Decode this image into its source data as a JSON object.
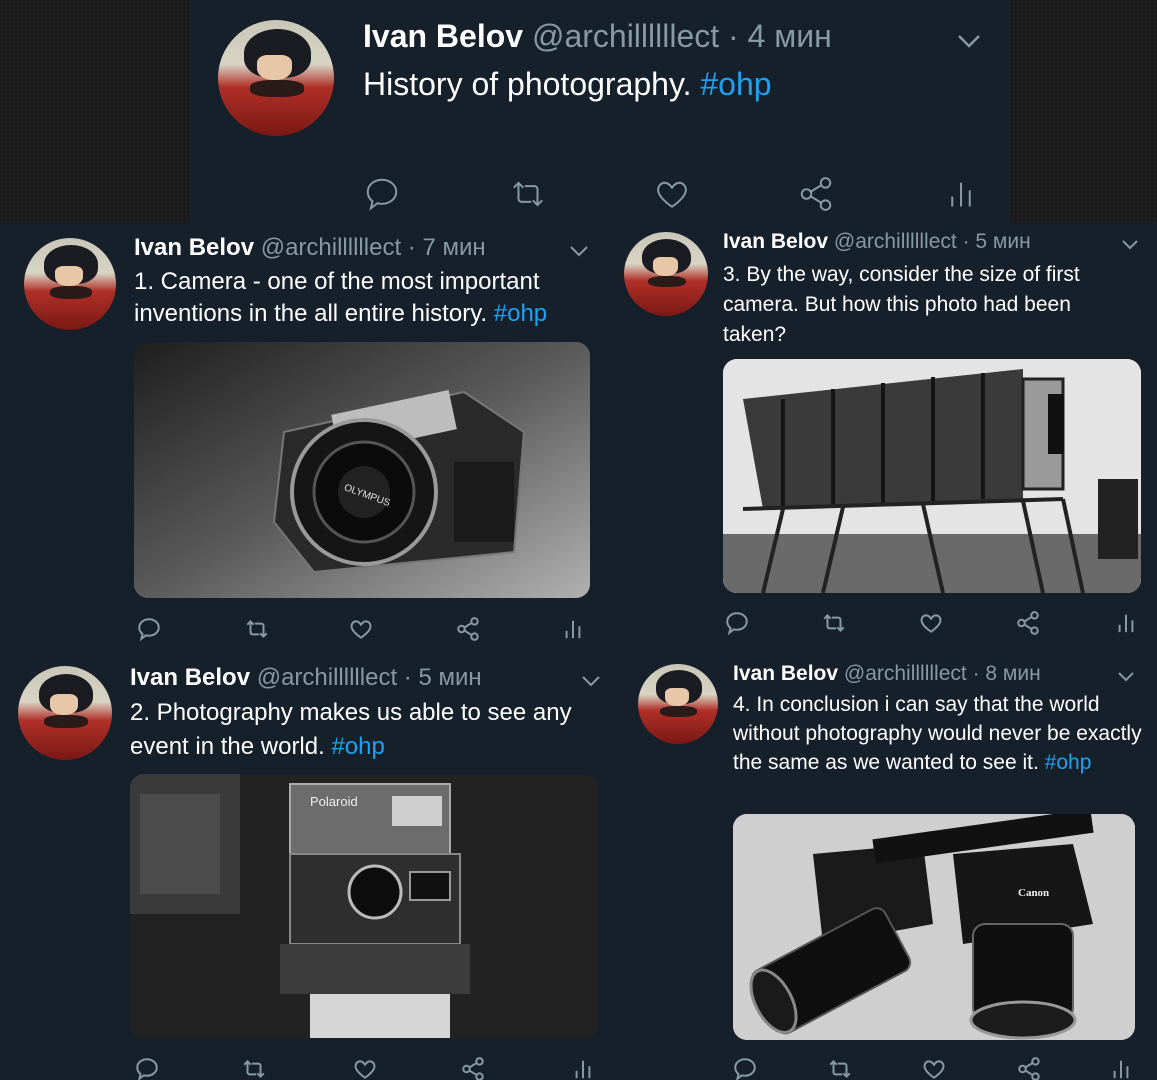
{
  "colors": {
    "background": "#15202b",
    "name": "#ffffff",
    "handle": "#8899a6",
    "link": "#1da1f2",
    "icon": "#8899a6"
  },
  "icons": [
    "reply-icon",
    "retweet-icon",
    "like-icon",
    "share-icon",
    "analytics-icon",
    "chevron-down-icon"
  ],
  "tweets": [
    {
      "name": "Ivan Belov",
      "handle": "@archillllllect",
      "sep": "·",
      "time": "4 мин",
      "text": "History of photography.",
      "hashtag": "#ohp"
    },
    {
      "name": "Ivan Belov",
      "handle": "@archillllllect",
      "sep": "·",
      "time": "7 мин",
      "text": "1. Camera - one of the most important inventions in the all entire history.",
      "hashtag": "#ohp",
      "image_brand_text": "OLYMPUS"
    },
    {
      "name": "Ivan Belov",
      "handle": "@archillllllect",
      "sep": "·",
      "time": "5 мин",
      "text": "3. By the way, consider the size of first camera. But how this photo had been taken?",
      "hashtag": ""
    },
    {
      "name": "Ivan Belov",
      "handle": "@archillllllect",
      "sep": "·",
      "time": "5 мин",
      "text": "2. Photography makes us able to see any event in the world.",
      "hashtag": "#ohp",
      "image_brand_text": "Polaroid"
    },
    {
      "name": "Ivan Belov",
      "handle": "@archillllllect",
      "sep": "·",
      "time": "8 мин",
      "text": "4. In conclusion i can say that the world without photography would never be exactly the same as we wanted to see it.",
      "hashtag": "#ohp",
      "image_brand_text": "Canon"
    }
  ]
}
